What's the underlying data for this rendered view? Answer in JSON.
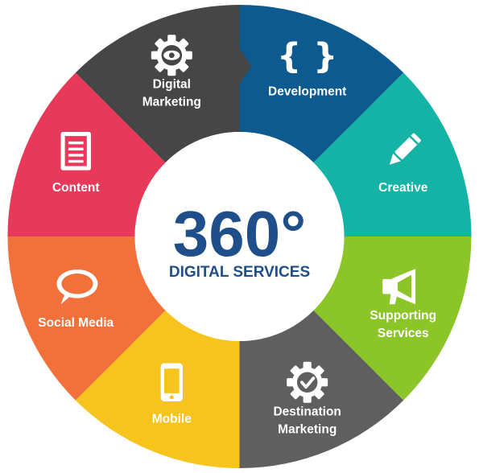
{
  "center": {
    "title": "360°",
    "subtitle": "DIGITAL SERVICES",
    "title_color": "#1e4f8a",
    "bg_color": "#ffffff"
  },
  "segments": [
    {
      "id": "development",
      "lines": [
        "Development"
      ],
      "color": "#0c5a90",
      "icon": "curly-braces-icon"
    },
    {
      "id": "creative",
      "lines": [
        "Creative"
      ],
      "color": "#14b3a5",
      "icon": "pencil-icon"
    },
    {
      "id": "supporting-services",
      "lines": [
        "Supporting",
        "Services"
      ],
      "color": "#8bc528",
      "icon": "megaphone-icon"
    },
    {
      "id": "destination-marketing",
      "lines": [
        "Destination",
        "Marketing"
      ],
      "color": "#5f5f5f",
      "icon": "gear-check-icon"
    },
    {
      "id": "mobile",
      "lines": [
        "Mobile"
      ],
      "color": "#f6c41d",
      "icon": "smartphone-icon"
    },
    {
      "id": "social-media",
      "lines": [
        "Social Media"
      ],
      "color": "#f2713b",
      "icon": "speech-bubble-icon"
    },
    {
      "id": "content",
      "lines": [
        "Content"
      ],
      "color": "#e9395b",
      "icon": "document-icon"
    },
    {
      "id": "digital-marketing",
      "lines": [
        "Digital",
        "Marketing"
      ],
      "color": "#464646",
      "icon": "gear-eye-icon"
    }
  ]
}
